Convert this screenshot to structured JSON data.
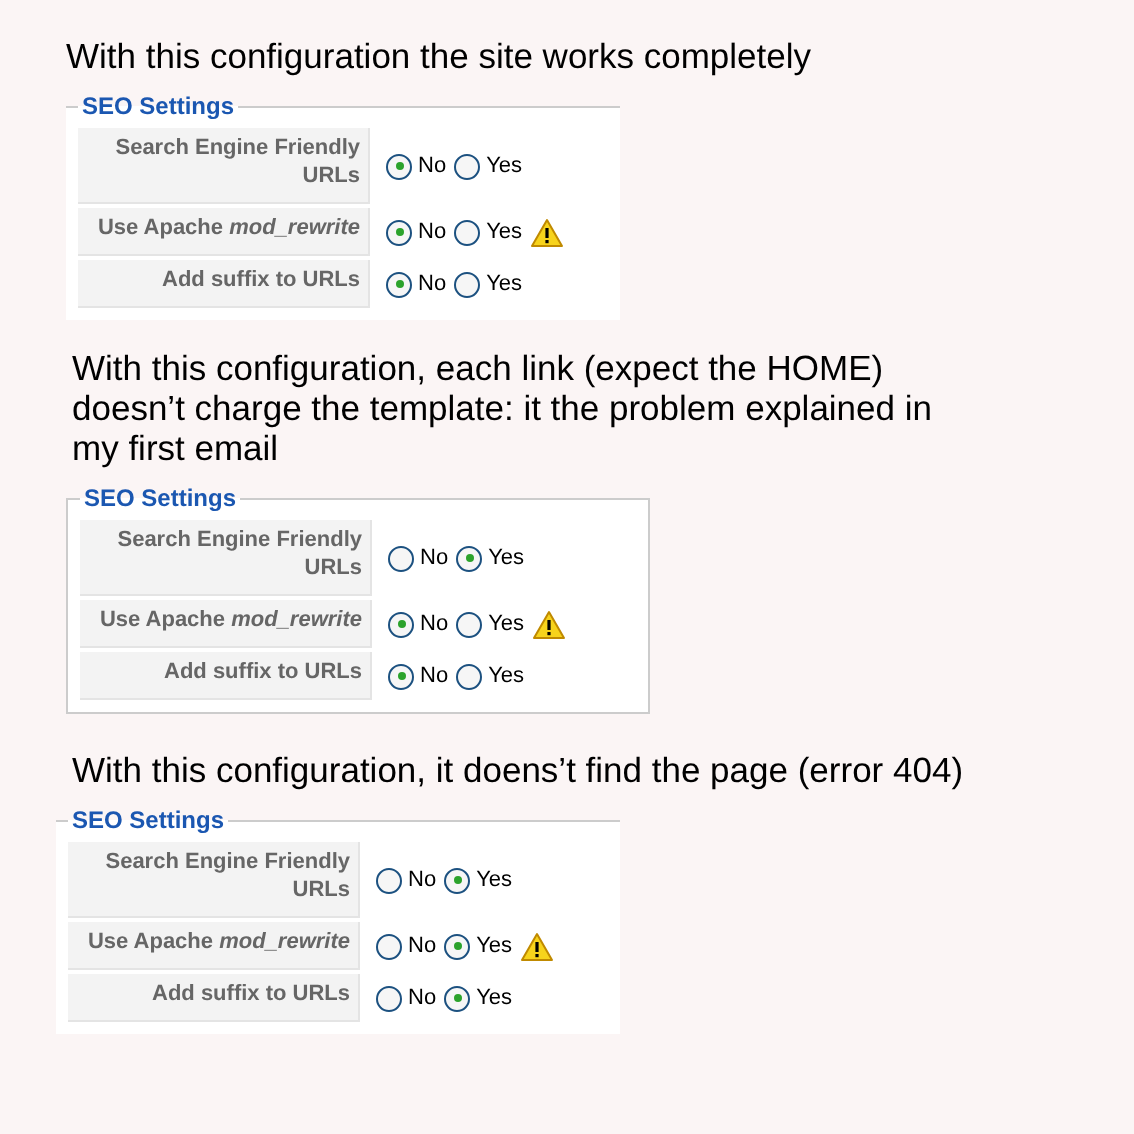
{
  "sections": [
    {
      "caption": "With this configuration the site works completely",
      "panel": {
        "legend": "SEO Settings",
        "bordered": false,
        "rows": [
          {
            "label": "Search Engine Friendly URLs",
            "warning": false,
            "options": [
              {
                "label": "No",
                "selected": true
              },
              {
                "label": "Yes",
                "selected": false
              }
            ]
          },
          {
            "label": "Use Apache *mod_rewrite*",
            "warning": true,
            "options": [
              {
                "label": "No",
                "selected": true
              },
              {
                "label": "Yes",
                "selected": false
              }
            ]
          },
          {
            "label": "Add suffix to URLs",
            "warning": false,
            "options": [
              {
                "label": "No",
                "selected": true
              },
              {
                "label": "Yes",
                "selected": false
              }
            ]
          }
        ]
      }
    },
    {
      "caption": "With this configuration, each link (expect the HOME) doesn’t charge the template: it the problem explained in my first email",
      "panel": {
        "legend": "SEO Settings",
        "bordered": true,
        "rows": [
          {
            "label": "Search Engine Friendly URLs",
            "warning": false,
            "options": [
              {
                "label": "No",
                "selected": false
              },
              {
                "label": "Yes",
                "selected": true
              }
            ]
          },
          {
            "label": "Use Apache *mod_rewrite*",
            "warning": true,
            "options": [
              {
                "label": "No",
                "selected": true
              },
              {
                "label": "Yes",
                "selected": false
              }
            ]
          },
          {
            "label": "Add suffix to URLs",
            "warning": false,
            "options": [
              {
                "label": "No",
                "selected": true
              },
              {
                "label": "Yes",
                "selected": false
              }
            ]
          }
        ]
      }
    },
    {
      "caption": "With this configuration, it doens’t find the page (error 404)",
      "panel": {
        "legend": "SEO Settings",
        "bordered": false,
        "rows": [
          {
            "label": "Search Engine Friendly URLs",
            "warning": false,
            "options": [
              {
                "label": "No",
                "selected": false
              },
              {
                "label": "Yes",
                "selected": true
              }
            ]
          },
          {
            "label": "Use Apache *mod_rewrite*",
            "warning": true,
            "options": [
              {
                "label": "No",
                "selected": false
              },
              {
                "label": "Yes",
                "selected": true
              }
            ]
          },
          {
            "label": "Add suffix to URLs",
            "warning": false,
            "options": [
              {
                "label": "No",
                "selected": false
              },
              {
                "label": "Yes",
                "selected": true
              }
            ]
          }
        ]
      }
    }
  ]
}
